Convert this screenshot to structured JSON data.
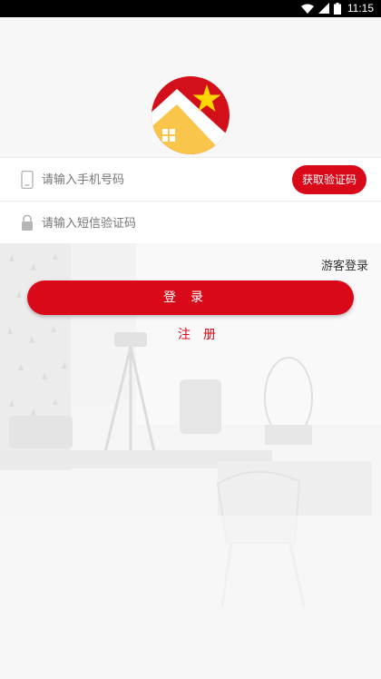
{
  "status_bar": {
    "time": "11:15"
  },
  "form": {
    "phone_placeholder": "请输入手机号码",
    "code_placeholder": "请输入短信验证码",
    "get_code_label": "获取验证码"
  },
  "actions": {
    "guest_login": "游客登录",
    "login": "登录",
    "register": "注册"
  },
  "colors": {
    "primary": "#d9091a",
    "logo_red": "#d31019",
    "logo_star": "#ffd700",
    "house_yellow": "#f9c54a"
  }
}
